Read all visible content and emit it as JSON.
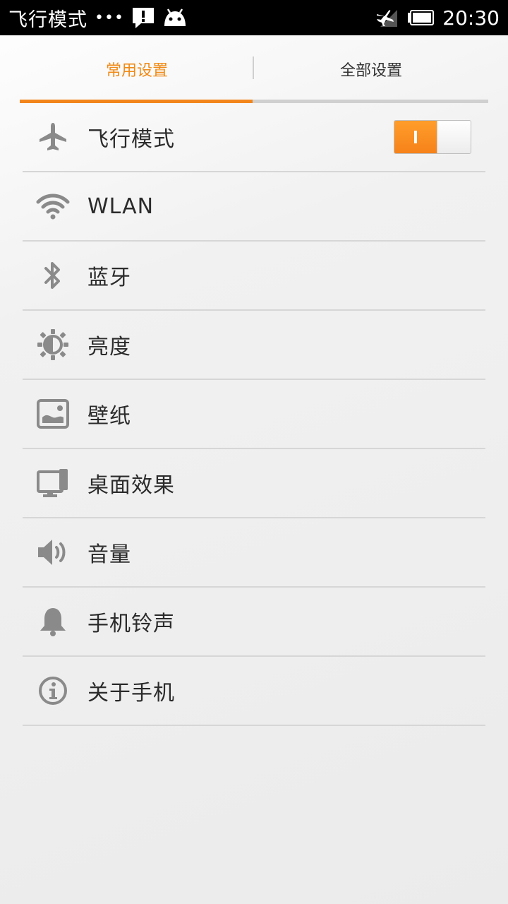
{
  "statusbar": {
    "title": "飞行模式",
    "dots": "•••",
    "time": "20:30"
  },
  "tabs": [
    {
      "label": "常用设置",
      "active": true
    },
    {
      "label": "全部设置",
      "active": false
    }
  ],
  "settings": {
    "items": [
      {
        "label": "飞行模式",
        "icon": "airplane-icon",
        "toggle": true
      },
      {
        "label": "WLAN",
        "icon": "wifi-icon"
      },
      {
        "label": "蓝牙",
        "icon": "bluetooth-icon"
      },
      {
        "label": "亮度",
        "icon": "brightness-icon"
      },
      {
        "label": "壁纸",
        "icon": "wallpaper-icon"
      },
      {
        "label": "桌面效果",
        "icon": "desktop-effect-icon"
      },
      {
        "label": "音量",
        "icon": "volume-icon"
      },
      {
        "label": "手机铃声",
        "icon": "bell-icon"
      },
      {
        "label": "关于手机",
        "icon": "info-icon"
      }
    ]
  },
  "colors": {
    "accent": "#f08a16",
    "icon": "#8a8a8a",
    "divider": "#d6d6d6"
  }
}
